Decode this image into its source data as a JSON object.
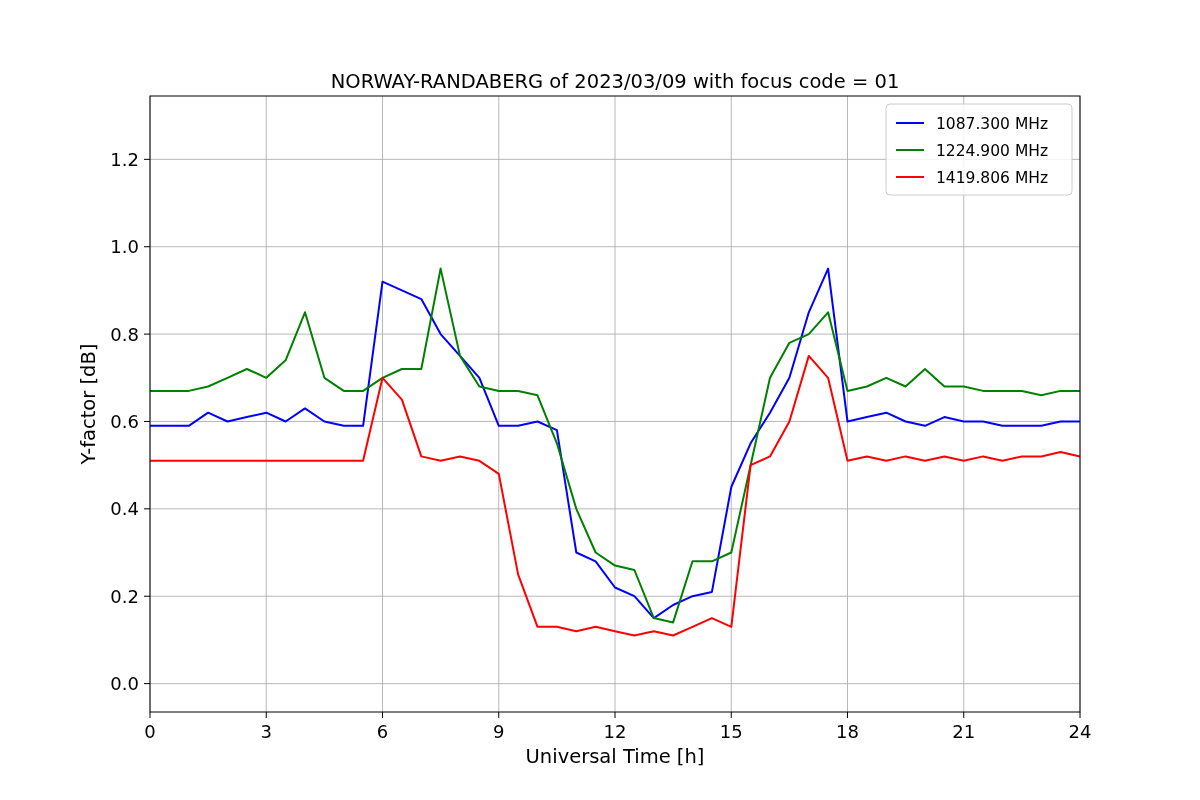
{
  "figure": {
    "chart_data": {
      "type": "line",
      "title": "NORWAY-RANDABERG of 2023/03/09 with focus code = 01",
      "xlabel": "Universal Time [h]",
      "ylabel": "Y-factor [dB]",
      "x": [
        0,
        0.5,
        1,
        1.5,
        2,
        2.5,
        3,
        3.5,
        4,
        4.5,
        5,
        5.5,
        6,
        6.5,
        7,
        7.5,
        8,
        8.5,
        9,
        9.5,
        10,
        10.5,
        11,
        11.5,
        12,
        12.5,
        13,
        13.5,
        14,
        14.5,
        15,
        15.5,
        16,
        16.5,
        17,
        17.5,
        18,
        18.5,
        19,
        19.5,
        20,
        20.5,
        21,
        21.5,
        22,
        22.5,
        23,
        23.5,
        24
      ],
      "series": [
        {
          "name": "1087.300 MHz",
          "color": "#0000ff",
          "values": [
            0.59,
            0.59,
            0.59,
            0.62,
            0.6,
            0.61,
            0.62,
            0.6,
            0.63,
            0.6,
            0.59,
            0.59,
            0.92,
            0.9,
            0.88,
            0.8,
            0.75,
            0.7,
            0.59,
            0.59,
            0.6,
            0.58,
            0.3,
            0.28,
            0.22,
            0.2,
            0.15,
            0.18,
            0.2,
            0.21,
            0.45,
            0.55,
            0.62,
            0.7,
            0.85,
            0.95,
            0.6,
            0.61,
            0.62,
            0.6,
            0.59,
            0.61,
            0.6,
            0.6,
            0.59,
            0.59,
            0.59,
            0.6,
            0.6
          ]
        },
        {
          "name": "1224.900 MHz",
          "color": "#008000",
          "values": [
            0.67,
            0.67,
            0.67,
            0.68,
            0.7,
            0.72,
            0.7,
            0.74,
            0.85,
            0.7,
            0.67,
            0.67,
            0.7,
            0.72,
            0.72,
            0.95,
            0.75,
            0.68,
            0.67,
            0.67,
            0.66,
            0.55,
            0.4,
            0.3,
            0.27,
            0.26,
            0.15,
            0.14,
            0.28,
            0.28,
            0.3,
            0.5,
            0.7,
            0.78,
            0.8,
            0.85,
            0.67,
            0.68,
            0.7,
            0.68,
            0.72,
            0.68,
            0.68,
            0.67,
            0.67,
            0.67,
            0.66,
            0.67,
            0.67
          ]
        },
        {
          "name": "1419.806 MHz",
          "color": "#ff0000",
          "values": [
            0.51,
            0.51,
            0.51,
            0.51,
            0.51,
            0.51,
            0.51,
            0.51,
            0.51,
            0.51,
            0.51,
            0.51,
            0.7,
            0.65,
            0.52,
            0.51,
            0.52,
            0.51,
            0.48,
            0.25,
            0.13,
            0.13,
            0.12,
            0.13,
            0.12,
            0.11,
            0.12,
            0.11,
            0.13,
            0.15,
            0.13,
            0.5,
            0.52,
            0.6,
            0.75,
            0.7,
            0.51,
            0.52,
            0.51,
            0.52,
            0.51,
            0.52,
            0.51,
            0.52,
            0.51,
            0.52,
            0.52,
            0.53,
            0.52
          ]
        }
      ],
      "grid": true,
      "legend": true,
      "xlim": [
        0,
        24
      ],
      "ylim": [
        -0.065,
        1.345
      ],
      "xticks": [
        0,
        3,
        6,
        9,
        12,
        15,
        18,
        21,
        24
      ],
      "yticks": [
        {
          "value": 0,
          "label": "0.0"
        },
        {
          "value": 0.2,
          "label": "0.2"
        },
        {
          "value": 0.4,
          "label": "0.4"
        },
        {
          "value": 0.6,
          "label": "0.6"
        },
        {
          "value": 0.8,
          "label": "0.8"
        },
        {
          "value": 1,
          "label": "1.0"
        },
        {
          "value": 1.2,
          "label": "1.2"
        }
      ]
    }
  }
}
